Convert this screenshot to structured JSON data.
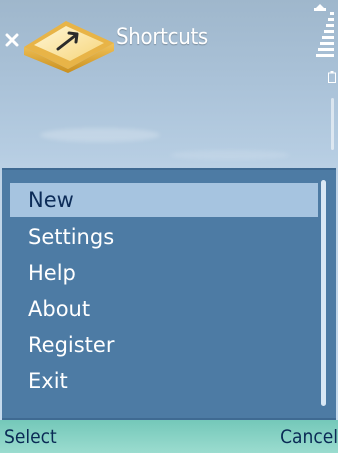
{
  "header": {
    "title": "Shortcuts",
    "icons": [
      "close-icon",
      "shortcuts-key-icon",
      "signal-strength-icon",
      "battery-icon"
    ]
  },
  "menu": {
    "items": [
      {
        "label": "New",
        "selected": true
      },
      {
        "label": "Settings"
      },
      {
        "label": "Help"
      },
      {
        "label": "About"
      },
      {
        "label": "Register"
      },
      {
        "label": "Exit"
      }
    ]
  },
  "softkeys": {
    "left": "Select",
    "right": "Cancel"
  },
  "colors": {
    "menu_background": "#4d7ba4",
    "selection": "#a6c4e0",
    "softkey_bar": "#86d2c4"
  }
}
